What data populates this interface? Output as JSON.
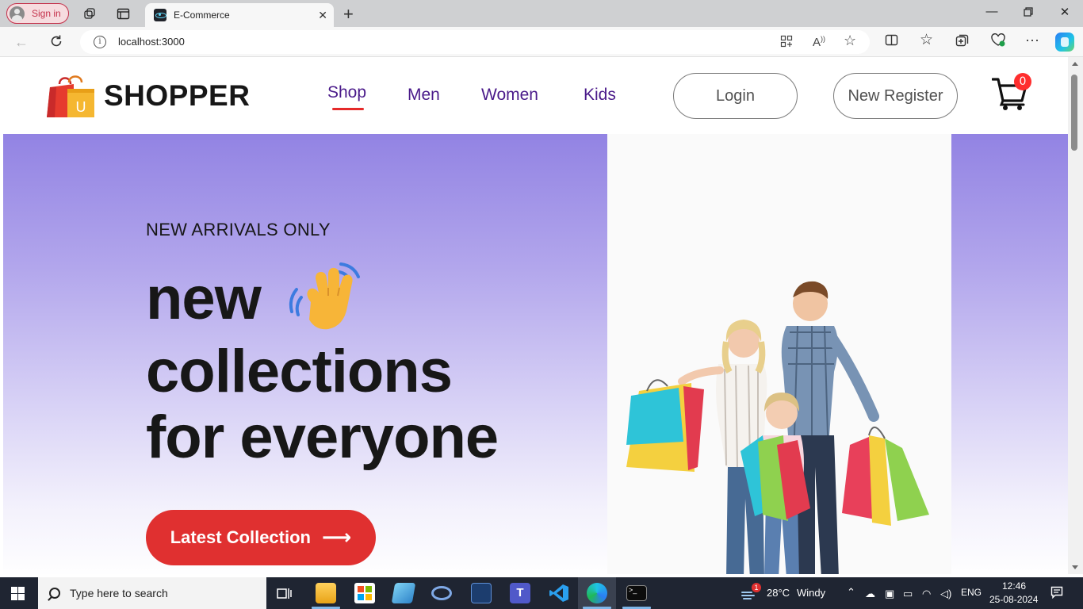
{
  "browser": {
    "signin_label": "Sign in",
    "tab_title": "E-Commerce",
    "url": "localhost:3000",
    "tab_icons": [
      "workspaces-icon",
      "tab-actions-icon"
    ],
    "omnibox_icons": [
      "app-available-icon",
      "read-aloud-icon",
      "favorite-star-icon"
    ],
    "toolbar_icons": [
      "split-screen-icon",
      "favorites-icon",
      "collections-icon",
      "browser-essentials-icon",
      "more-icon",
      "copilot-icon"
    ]
  },
  "site": {
    "brand": "SHOPPER",
    "menu": [
      {
        "label": "Shop",
        "active": true
      },
      {
        "label": "Men",
        "active": false
      },
      {
        "label": "Women",
        "active": false
      },
      {
        "label": "Kids",
        "active": false
      }
    ],
    "login_label": "Login",
    "register_label": "New Register",
    "cart_count": "0"
  },
  "hero": {
    "eyebrow": "NEW ARRIVALS ONLY",
    "line1": "new",
    "line2": "collections",
    "line3": "for everyone",
    "cta_label": "Latest Collection",
    "cta_arrow": "⟶"
  },
  "taskbar": {
    "search_placeholder": "Type here to search",
    "weather_temp": "28°C",
    "weather_desc": "Windy",
    "weather_badge": "1",
    "language": "ENG",
    "time": "12:46",
    "date": "25-08-2024"
  },
  "colors": {
    "accent_red": "#e03030",
    "menu_purple": "#4a1a8a",
    "hero_top": "#9283e3"
  }
}
